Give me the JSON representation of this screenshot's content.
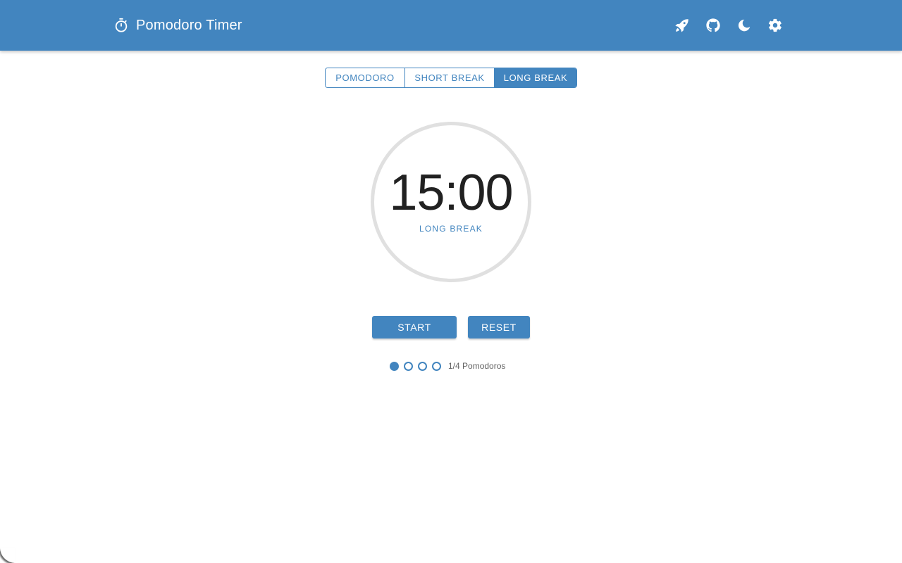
{
  "app": {
    "title": "Pomodoro Timer",
    "accent_color": "#4285bf",
    "brand_icon": "timer-icon"
  },
  "header": {
    "actions": [
      {
        "name": "rocket-icon"
      },
      {
        "name": "github-icon"
      },
      {
        "name": "dark-mode-icon"
      },
      {
        "name": "settings-icon"
      }
    ]
  },
  "modes": {
    "pomodoro": "POMODORO",
    "short_break": "SHORT BREAK",
    "long_break": "LONG BREAK",
    "active": "long_break"
  },
  "timer": {
    "time": "15:00",
    "label": "LONG BREAK",
    "progress": 0
  },
  "controls": {
    "start": "START",
    "reset": "RESET"
  },
  "pomodoros": {
    "completed": 1,
    "total": 4,
    "summary": "1/4 Pomodoros"
  }
}
